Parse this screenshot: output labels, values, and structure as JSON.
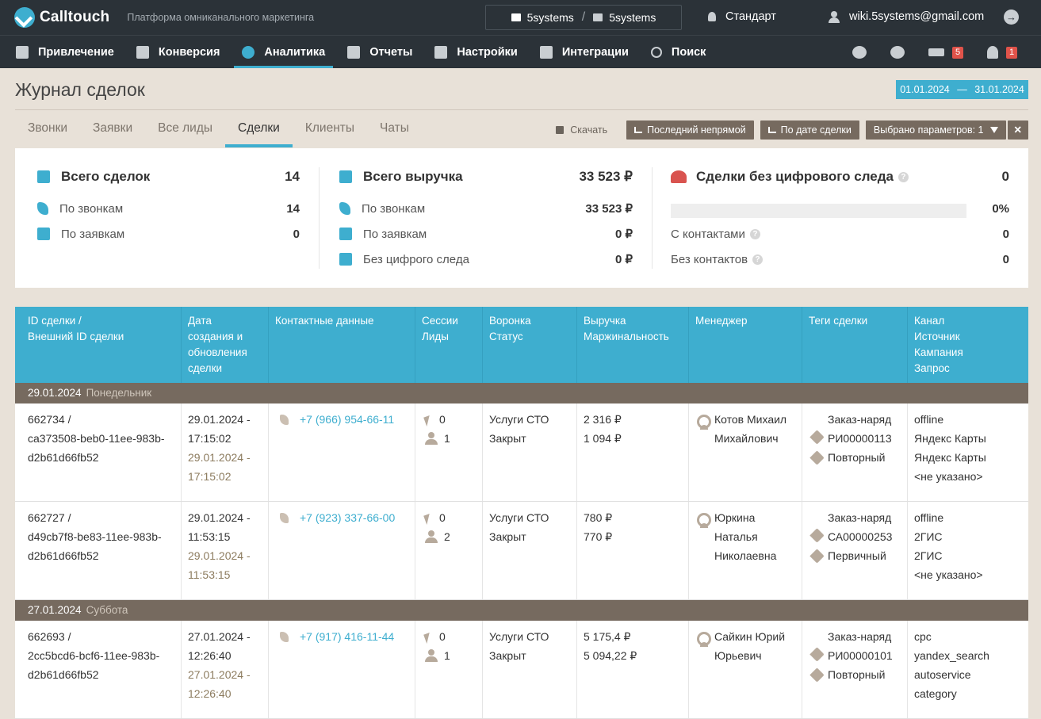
{
  "app": {
    "name": "Calltouch",
    "tagline": "Платформа омниканального маркетинга",
    "project_from": "5systems",
    "project_to": "5systems",
    "plan": "Стандарт",
    "user_email": "wiki.5systems@gmail.com"
  },
  "nav": {
    "items": [
      {
        "label": "Привлечение",
        "icon": "megaphone-icon"
      },
      {
        "label": "Конверсия",
        "icon": "conversion-icon"
      },
      {
        "label": "Аналитика",
        "icon": "analytics-icon"
      },
      {
        "label": "Отчеты",
        "icon": "chart-icon"
      },
      {
        "label": "Настройки",
        "icon": "settings-icon"
      },
      {
        "label": "Интеграции",
        "icon": "integrations-icon"
      },
      {
        "label": "Поиск",
        "icon": "search-icon"
      }
    ],
    "active": "Аналитика",
    "education_badge": "5",
    "notifications_badge": "1"
  },
  "page": {
    "title": "Журнал сделок",
    "date_from": "01.01.2024",
    "date_sep": "—",
    "date_to": "31.01.2024"
  },
  "tabs": [
    "Звонки",
    "Заявки",
    "Все лиды",
    "Сделки",
    "Клиенты",
    "Чаты"
  ],
  "active_tab": "Сделки",
  "toolbar": {
    "download": "Скачать",
    "attribution": "Последний непрямой",
    "date_mode": "По дате сделки",
    "params": "Выбрано параметров: 1",
    "close": "✕"
  },
  "summary": {
    "deals": {
      "title": "Всего сделок",
      "total": "14",
      "by_calls_label": "По звонкам",
      "by_calls": "14",
      "by_requests_label": "По заявкам",
      "by_requests": "0"
    },
    "revenue": {
      "title": "Всего выручка",
      "total": "33 523 ₽",
      "by_calls_label": "По звонкам",
      "by_calls": "33 523 ₽",
      "by_requests_label": "По заявкам",
      "by_requests": "0 ₽",
      "no_trace_label": "Без цифрого следа",
      "no_trace": "0 ₽"
    },
    "no_trace": {
      "title": "Сделки без цифрового следа",
      "total": "0",
      "percent": "0%",
      "percent_value": 0,
      "with_contacts_label": "С контактами",
      "with_contacts": "0",
      "without_contacts_label": "Без контактов",
      "without_contacts": "0"
    }
  },
  "table": {
    "headers": [
      [
        "ID сделки /",
        "Внешний ID сделки"
      ],
      [
        "Дата",
        "создания и",
        "обновления",
        "сделки"
      ],
      [
        "Контактные данные"
      ],
      [
        "Сессии",
        "Лиды"
      ],
      [
        "Воронка",
        "Статус"
      ],
      [
        "Выручка",
        "Маржинальность"
      ],
      [
        "Менеджер"
      ],
      [
        "Теги сделки"
      ],
      [
        "Канал",
        "Источник",
        "Кампания",
        "Запрос"
      ]
    ],
    "groups": [
      {
        "date": "29.01.2024",
        "weekday": "Понедельник",
        "rows": [
          {
            "id": [
              "662734 /",
              "ca373508-beb0-11ee-983b-",
              "d2b61d66fb52"
            ],
            "created": [
              "29.01.2024 -",
              "17:15:02"
            ],
            "updated": [
              "29.01.2024 -",
              "17:15:02"
            ],
            "phone": "+7 (966) 954-66-11",
            "sessions": "0",
            "leads": "1",
            "funnel": "Услуги СТО",
            "status": "Закрыт",
            "revenue": "2 316 ₽",
            "margin": "1 094 ₽",
            "manager": [
              "Котов Михаил",
              "Михайлович"
            ],
            "tags": [
              [
                "Заказ-наряд",
                "РИ00000113"
              ],
              [
                "Повторный"
              ]
            ],
            "channel": [
              "offline",
              "Яндекс Карты",
              "Яндекс Карты",
              "<не указано>"
            ]
          },
          {
            "id": [
              "662727 /",
              "d49cb7f8-be83-11ee-983b-",
              "d2b61d66fb52"
            ],
            "created": [
              "29.01.2024 -",
              "11:53:15"
            ],
            "updated": [
              "29.01.2024 -",
              "11:53:15"
            ],
            "phone": "+7 (923) 337-66-00",
            "sessions": "0",
            "leads": "2",
            "funnel": "Услуги СТО",
            "status": "Закрыт",
            "revenue": "780 ₽",
            "margin": "770 ₽",
            "manager": [
              "Юркина",
              "Наталья",
              "Николаевна"
            ],
            "tags": [
              [
                "Заказ-наряд",
                "СА00000253"
              ],
              [
                "Первичный"
              ]
            ],
            "channel": [
              "offline",
              "2ГИС",
              "2ГИС",
              "<не указано>"
            ]
          }
        ]
      },
      {
        "date": "27.01.2024",
        "weekday": "Суббота",
        "rows": [
          {
            "id": [
              "662693 /",
              "2cc5bcd6-bcf6-11ee-983b-",
              "d2b61d66fb52"
            ],
            "created": [
              "27.01.2024 -",
              "12:26:40"
            ],
            "updated": [
              "27.01.2024 -",
              "12:26:40"
            ],
            "phone": "+7 (917) 416-11-44",
            "sessions": "0",
            "leads": "1",
            "funnel": "Услуги СТО",
            "status": "Закрыт",
            "revenue": "5 175,4 ₽",
            "margin": "5 094,22 ₽",
            "manager": [
              "Сайкин Юрий",
              "Юрьевич"
            ],
            "tags": [
              [
                "Заказ-наряд",
                "РИ00000101"
              ],
              [
                "Повторный"
              ]
            ],
            "channel": [
              "cpc",
              "yandex_search",
              "autoservice",
              "category"
            ]
          }
        ]
      }
    ]
  },
  "colors": {
    "accent": "#3eaecf",
    "topbar": "#2b3238",
    "group": "#766a5f",
    "page_bg": "#e8e1d8",
    "danger": "#e0534a"
  }
}
